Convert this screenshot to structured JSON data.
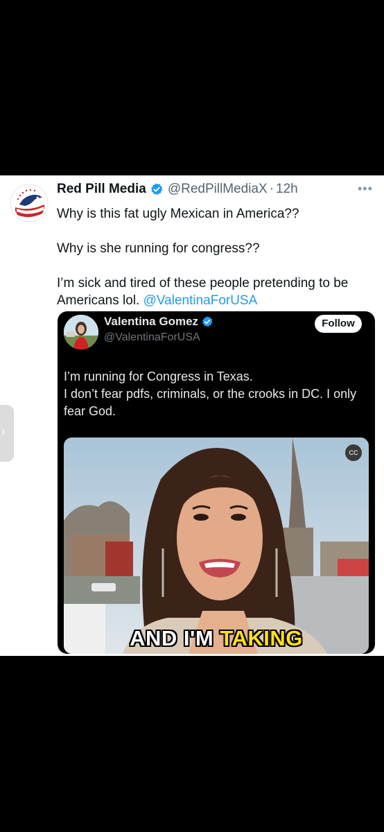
{
  "tweet": {
    "display_name": "Red Pill Media",
    "handle": "@RedPillMediaX",
    "separator": "·",
    "time": "12h",
    "more_glyph": "•••",
    "paragraphs": [
      "Why is this fat ugly Mexican in America??",
      "Why is she running for congress??",
      "I’m sick and tired of these people pretending to be Americans lol."
    ],
    "mention": "@ValentinaForUSA"
  },
  "quote": {
    "display_name": "Valentina Gomez",
    "handle": "@ValentinaForUSA",
    "follow_label": "Follow",
    "text_lines": [
      "I’m running for Congress in Texas.",
      "I don’t fear pdfs, criminals, or the crooks in DC. I only fear God."
    ],
    "video": {
      "cc_label": "CC",
      "caption_white": "AND I'M ",
      "caption_yellow": "TAKING"
    }
  },
  "side_tab": {
    "glyph": "›"
  },
  "colors": {
    "link": "#1d9bf0",
    "verified": "#1d9bf0",
    "caption_highlight": "#ffe01a"
  }
}
